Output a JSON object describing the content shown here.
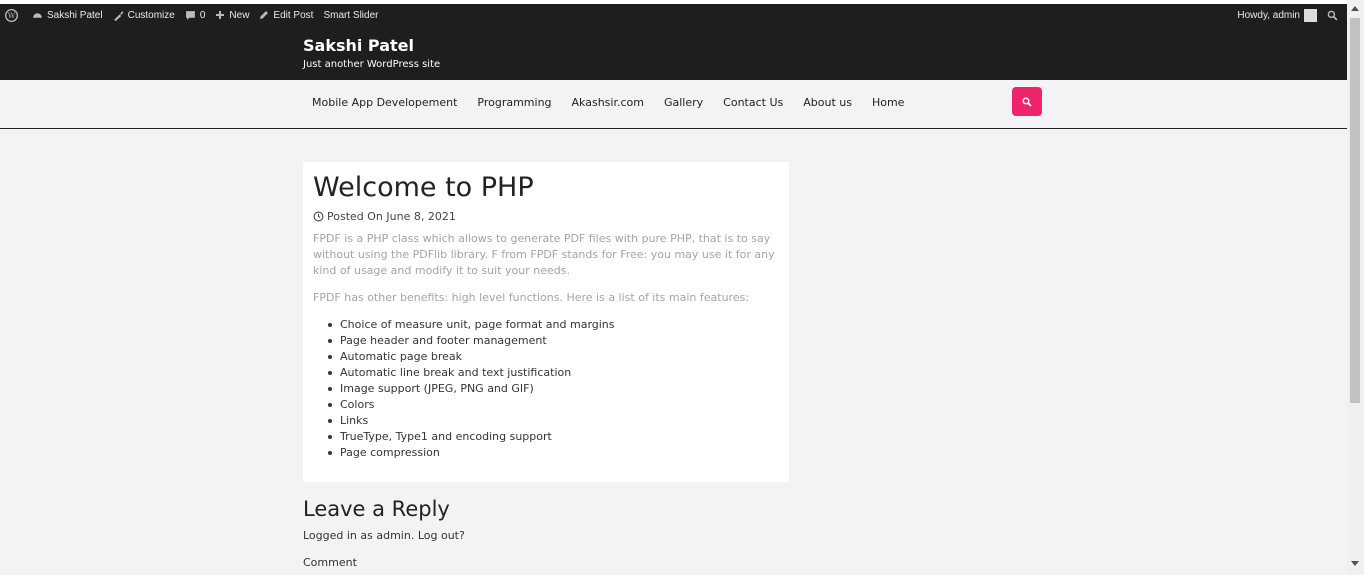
{
  "adminbar": {
    "site_name": "Sakshi Patel",
    "customize": "Customize",
    "comments_count": "0",
    "new": "New",
    "edit_post": "Edit Post",
    "smart_slider": "Smart Slider",
    "howdy": "Howdy, admin"
  },
  "header": {
    "title": "Sakshi Patel",
    "description": "Just another WordPress site"
  },
  "menu": [
    "Mobile App Developement",
    "Programming",
    "Akashsir.com",
    "Gallery",
    "Contact Us",
    "About us",
    "Home"
  ],
  "post": {
    "title": "Welcome to PHP",
    "posted_on": "Posted On June 8, 2021",
    "paragraph1": "FPDF is a PHP class which allows to generate PDF files with pure PHP, that is to say without using the PDFlib library. F from FPDF stands for Free: you may use it for any kind of usage and modify it to suit your needs.",
    "paragraph2": "FPDF has other benefits: high level functions. Here is a list of its main features:",
    "features": [
      "Choice of measure unit, page format and margins",
      "Page header and footer management",
      "Automatic page break",
      "Automatic line break and text justification",
      "Image support (JPEG, PNG and GIF)",
      "Colors",
      "Links",
      "TrueType, Type1 and encoding support",
      "Page compression"
    ]
  },
  "reply": {
    "title": "Leave a Reply",
    "logged_in": "Logged in as admin. Log out?",
    "comment_label": "Comment"
  },
  "colors": {
    "accent": "#f0246b",
    "header_bg": "#1e1e1e",
    "page_bg": "#f3f3f6"
  }
}
